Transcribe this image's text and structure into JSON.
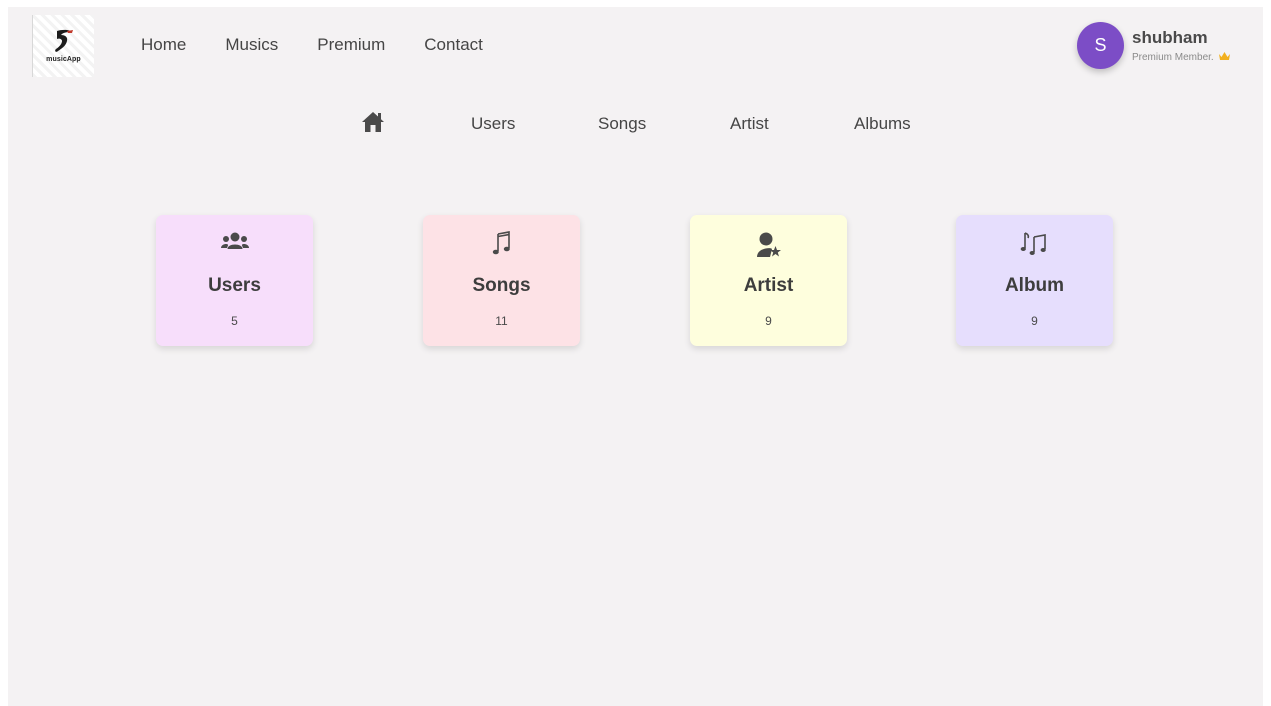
{
  "logo": {
    "text": "musicApp",
    "icon": "music-logo-icon"
  },
  "top_nav": {
    "home": "Home",
    "musics": "Musics",
    "premium": "Premium",
    "contact": "Contact"
  },
  "profile": {
    "initial": "S",
    "name": "shubham",
    "membership": "Premium Member.",
    "avatar_color": "#7c4dc6",
    "badge_icon": "crown-icon"
  },
  "dash_nav": {
    "home_icon": "home-icon",
    "users": "Users",
    "songs": "Songs",
    "artist": "Artist",
    "albums": "Albums"
  },
  "cards": [
    {
      "title": "Users",
      "count": "5",
      "icon": "users-icon",
      "color": "#f7defb"
    },
    {
      "title": "Songs",
      "count": "11",
      "icon": "music-note-icon",
      "color": "#fde2e6"
    },
    {
      "title": "Artist",
      "count": "9",
      "icon": "user-star-icon",
      "color": "#fefedd"
    },
    {
      "title": "Album",
      "count": "9",
      "icon": "music-notes-icon",
      "color": "#e6defd"
    }
  ]
}
